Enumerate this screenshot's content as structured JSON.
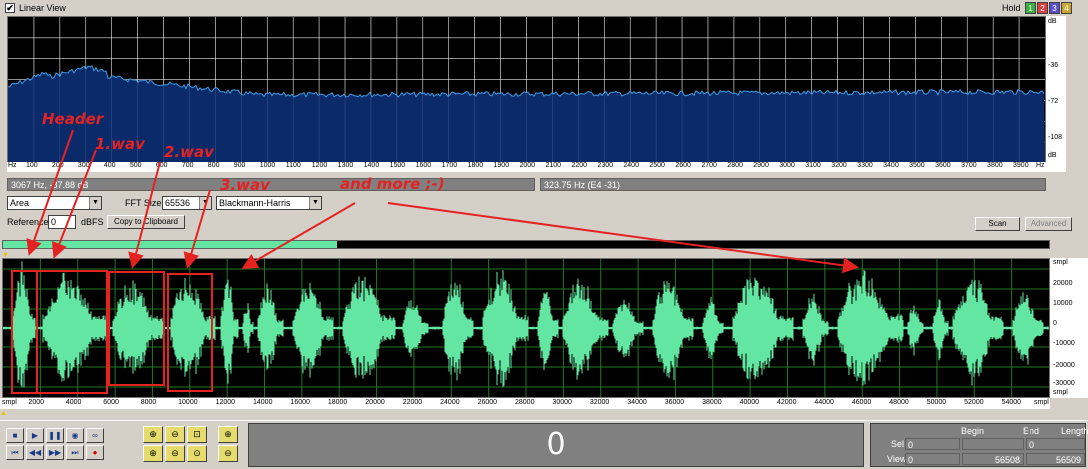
{
  "header": {
    "checkbox_mark": "✔",
    "title": "Linear View",
    "hold_label": "Hold",
    "hold_buttons": [
      {
        "label": "1",
        "color": "#3cb043"
      },
      {
        "label": "2",
        "color": "#d94040"
      },
      {
        "label": "3",
        "color": "#5a4fc8"
      },
      {
        "label": "4",
        "color": "#c8a832"
      }
    ]
  },
  "spectrum": {
    "db_labels": [
      "dB",
      "-36",
      "-72",
      "-108",
      "dB"
    ],
    "freq_ticks": [
      "Hz",
      "100",
      "200",
      "300",
      "400",
      "500",
      "600",
      "700",
      "800",
      "900",
      "1000",
      "1100",
      "1200",
      "1300",
      "1400",
      "1500",
      "1600",
      "1700",
      "1800",
      "1900",
      "2000",
      "2100",
      "2200",
      "2300",
      "2400",
      "2500",
      "2600",
      "2700",
      "2800",
      "2900",
      "3000",
      "3100",
      "3200",
      "3300",
      "3400",
      "3500",
      "3600",
      "3700",
      "3800",
      "3900",
      "Hz"
    ],
    "fill_color": "#0b2a6a",
    "line_color": "#3c9ee8",
    "grid_color": "#ffffff"
  },
  "readouts": {
    "left": "3067 Hz, -87.88 dB",
    "right": "323.75 Hz (E4 -31)"
  },
  "controls": {
    "display_mode": "Area",
    "fft_label": "FFT Size",
    "fft_value": "65536",
    "window_value": "Blackmann-Harris",
    "reference_label": "Reference",
    "reference_value": "0",
    "dbfs_label": "dBFS",
    "copy_button": "Copy to Clipboard",
    "scan_button": "Scan",
    "advanced_button": "Advanced"
  },
  "waveform": {
    "amp_labels": [
      "smpl",
      "20000",
      "10000",
      "0",
      "-10000",
      "-20000",
      "-30000",
      "smpl"
    ],
    "sample_ticks": [
      "smpl",
      "2000",
      "4000",
      "6000",
      "8000",
      "10000",
      "12000",
      "14000",
      "16000",
      "18000",
      "20000",
      "22000",
      "24000",
      "26000",
      "28000",
      "30000",
      "32000",
      "34000",
      "36000",
      "38000",
      "40000",
      "42000",
      "44000",
      "46000",
      "48000",
      "50000",
      "52000",
      "54000",
      "smpl"
    ],
    "wave_color": "#63e6a2",
    "grid_color": "#1f7a1f"
  },
  "annotations": {
    "header": "Header",
    "wav1": "1.wav",
    "wav2": "2.wav",
    "wav3": "3.wav",
    "more": "and more ;-)",
    "color": "#e52222"
  },
  "transport": {
    "row1": [
      {
        "icon": "stop-icon",
        "glyph": "■"
      },
      {
        "icon": "play-icon",
        "glyph": "▶"
      },
      {
        "icon": "pause-icon",
        "glyph": "❚❚"
      },
      {
        "icon": "play-selection-icon",
        "glyph": "◉"
      },
      {
        "icon": "loop-icon",
        "glyph": "∞"
      }
    ],
    "row2": [
      {
        "icon": "goto-start-icon",
        "glyph": "⏮"
      },
      {
        "icon": "rewind-icon",
        "glyph": "◀◀"
      },
      {
        "icon": "fast-forward-icon",
        "glyph": "▶▶"
      },
      {
        "icon": "goto-end-icon",
        "glyph": "⏭"
      },
      {
        "icon": "record-icon",
        "glyph": "●"
      }
    ],
    "zoom_row1": [
      {
        "icon": "zoom-in-icon",
        "glyph": "⊕"
      },
      {
        "icon": "zoom-out-icon",
        "glyph": "⊖"
      },
      {
        "icon": "zoom-selection-icon",
        "glyph": "⊡"
      },
      {
        "icon": "zoom-vertical-in-icon",
        "glyph": "⊕"
      }
    ],
    "zoom_row2": [
      {
        "icon": "zoom-full-icon",
        "glyph": "⊕"
      },
      {
        "icon": "zoom-previous-icon",
        "glyph": "⊖"
      },
      {
        "icon": "zoom-fit-icon",
        "glyph": "⊙"
      },
      {
        "icon": "zoom-vertical-out-icon",
        "glyph": "⊖"
      }
    ],
    "counter": "0"
  },
  "selection_info": {
    "headers": [
      "Begin",
      "End",
      "Length"
    ],
    "sel_label": "Sel",
    "sel_values": [
      "0",
      "",
      "0"
    ],
    "view_label": "View",
    "view_values": [
      "0",
      "56508",
      "56509"
    ]
  }
}
